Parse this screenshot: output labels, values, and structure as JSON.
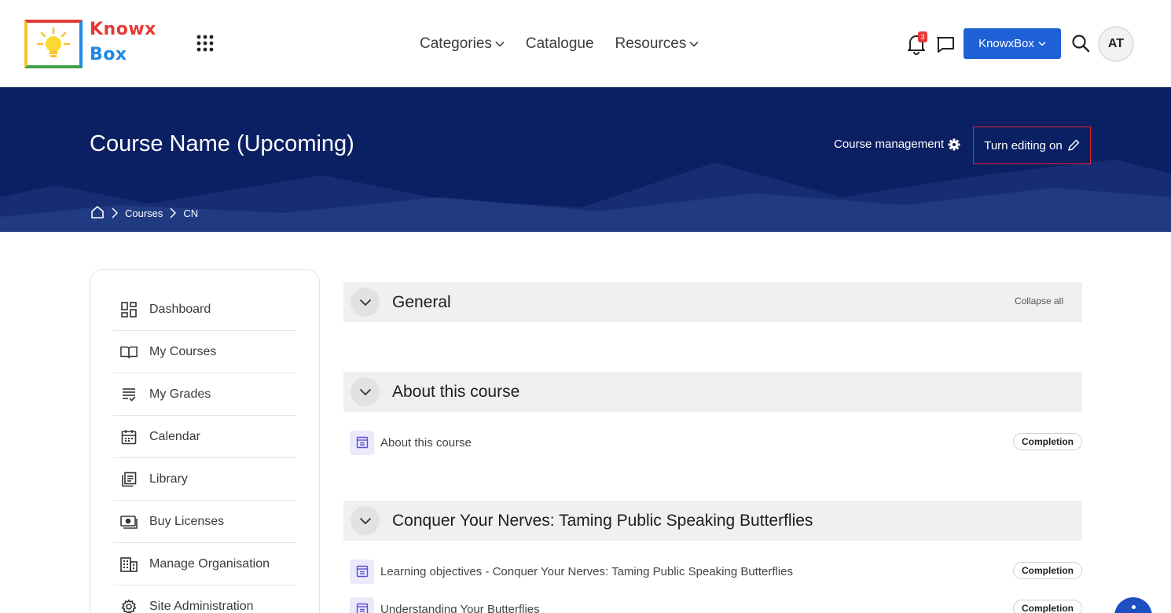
{
  "brand": {
    "line1": "Knowx",
    "line2": "Box"
  },
  "nav": {
    "categories": "Categories",
    "catalogue": "Catalogue",
    "resources": "Resources"
  },
  "header": {
    "notification_count": "3",
    "org_button": "KnowxBox",
    "avatar_initials": "AT"
  },
  "hero": {
    "title": "Course Name (Upcoming)",
    "course_management": "Course management",
    "edit_button": "Turn editing on",
    "breadcrumb": [
      "Courses",
      "CN"
    ]
  },
  "sidebar": {
    "items": [
      {
        "label": "Dashboard",
        "icon": "dashboard-icon"
      },
      {
        "label": "My Courses",
        "icon": "book-icon"
      },
      {
        "label": "My Grades",
        "icon": "grades-icon"
      },
      {
        "label": "Calendar",
        "icon": "calendar-icon"
      },
      {
        "label": "Library",
        "icon": "library-icon"
      },
      {
        "label": "Buy Licenses",
        "icon": "license-icon"
      },
      {
        "label": "Manage Organisation",
        "icon": "building-icon"
      },
      {
        "label": "Site Administration",
        "icon": "gear-icon"
      }
    ]
  },
  "course": {
    "collapse_all": "Collapse all",
    "sections": [
      {
        "title": "General",
        "activities": []
      },
      {
        "title": "About this course",
        "activities": [
          {
            "name": "About this course",
            "badge": "Completion"
          }
        ]
      },
      {
        "title": "Conquer Your Nerves: Taming Public Speaking Butterflies",
        "activities": [
          {
            "name": "Learning objectives - Conquer Your Nerves: Taming Public Speaking Butterflies",
            "badge": "Completion"
          },
          {
            "name": "Understanding Your Butterflies",
            "badge": "Completion"
          }
        ]
      }
    ]
  },
  "colors": {
    "hero_bg": "#0b1f63",
    "primary_button": "#1e60d6",
    "highlight_border": "#e8232a"
  }
}
